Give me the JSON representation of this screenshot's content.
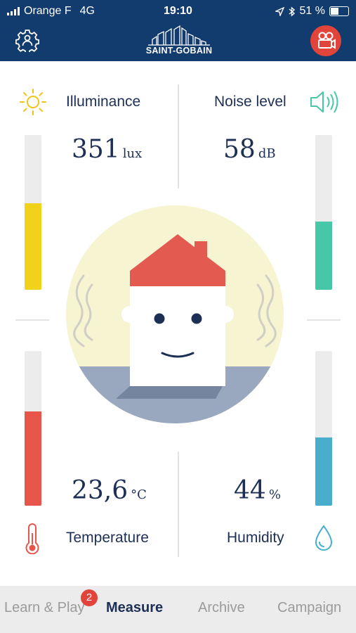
{
  "status_bar": {
    "carrier": "Orange F",
    "network": "4G",
    "time": "19:10",
    "battery_percent": "51 %",
    "battery_level": 0.51
  },
  "header": {
    "brand": "SAINT-GOBAIN",
    "settings_icon": "settings-gear-icon",
    "video_icon": "video-camera-icon"
  },
  "metrics": {
    "illuminance": {
      "label": "Illuminance",
      "value": "351",
      "unit": "lux",
      "icon": "sun-icon",
      "level": 0.56,
      "color": "#f0d21a"
    },
    "noise": {
      "label": "Noise level",
      "value": "58",
      "unit": "dB",
      "icon": "speaker-icon",
      "level": 0.44,
      "color": "#46c8a8"
    },
    "temperature": {
      "label": "Temperature",
      "value": "23,6",
      "unit": "°C",
      "icon": "thermometer-icon",
      "level": 0.61,
      "color": "#e8564b"
    },
    "humidity": {
      "label": "Humidity",
      "value": "44",
      "unit": "%",
      "icon": "water-drop-icon",
      "level": 0.44,
      "color": "#48aecb"
    }
  },
  "colors": {
    "header_bg": "#123c6e",
    "accent_red": "#e0443a",
    "text_dark": "#1e2f55",
    "circle_bg": "#f7f4d2",
    "ground": "#9aa8bf"
  },
  "tabs": [
    {
      "label": "Learn & Play",
      "badge": "2"
    },
    {
      "label": "Measure"
    },
    {
      "label": "Archive"
    },
    {
      "label": "Campaign"
    }
  ],
  "active_tab": "Measure"
}
